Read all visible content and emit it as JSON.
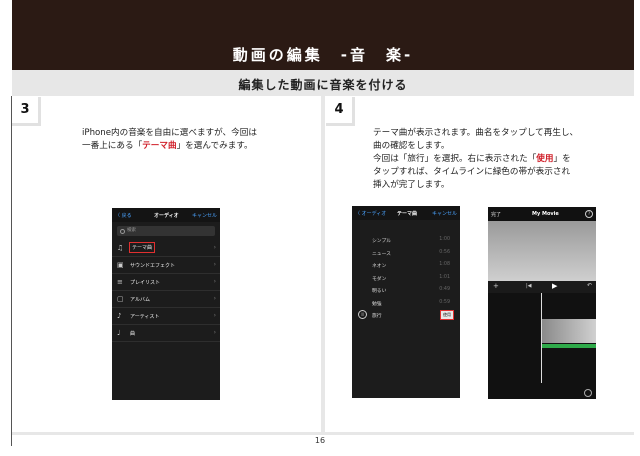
{
  "header": {
    "title": "動画の編集　-音　楽-"
  },
  "subheader": {
    "title": "編集した動画に音楽を付ける"
  },
  "steps": [
    {
      "number": "3",
      "text_line1": "iPhone内の音楽を自由に選べますが、今回は",
      "text_line2_pre": "一番上にある「",
      "text_line2_red": "テーマ曲",
      "text_line2_post": "」を選んでみます。"
    },
    {
      "number": "4",
      "lines": [
        "テーマ曲が表示されます。曲名をタップして再生し、",
        "曲の確認をします。"
      ],
      "line3_pre": "今回は「旅行」を選択。右に表示された「",
      "line3_red": "使用",
      "line3_post": "」を",
      "line4": "タップすれば、タイムラインに緑色の帯が表示され",
      "line5": "挿入が完了します。"
    }
  ],
  "screen_audio": {
    "back": "〈 戻る",
    "title": "オーディオ",
    "cancel": "キャンセル",
    "search_placeholder": "検索",
    "items": [
      {
        "icon": "music-note-icon",
        "glyph": "♫",
        "label": "テーマ曲"
      },
      {
        "icon": "sound-effect-icon",
        "glyph": "▣",
        "label": "サウンドエフェクト"
      },
      {
        "icon": "playlist-icon",
        "glyph": "≡",
        "label": "プレイリスト"
      },
      {
        "icon": "album-icon",
        "glyph": "▢",
        "label": "アルバム"
      },
      {
        "icon": "artist-icon",
        "glyph": "♪",
        "label": "アーティスト"
      },
      {
        "icon": "song-icon",
        "glyph": "♩",
        "label": "曲"
      }
    ]
  },
  "screen_theme": {
    "back": "〈 オーディオ",
    "title": "テーマ曲",
    "cancel": "キャンセル",
    "tracks": [
      {
        "label": "シンプル",
        "time": "1:00"
      },
      {
        "label": "ニュース",
        "time": "0:56"
      },
      {
        "label": "ネオン",
        "time": "1:08"
      },
      {
        "label": "モダン",
        "time": "1:01"
      },
      {
        "label": "明るい",
        "time": "0:49"
      },
      {
        "label": "勉強",
        "time": "0:59"
      },
      {
        "label": "旅行",
        "time": ""
      }
    ],
    "use_label": "使用"
  },
  "screen_imovie": {
    "done": "完了",
    "title": "My Movie",
    "help": "?"
  },
  "page_number": "16",
  "colors": {
    "header_bg": "#2b1a14",
    "accent_red": "#d0202a",
    "ios_blue": "#4aa3ff",
    "audio_green": "#2faa4a"
  }
}
